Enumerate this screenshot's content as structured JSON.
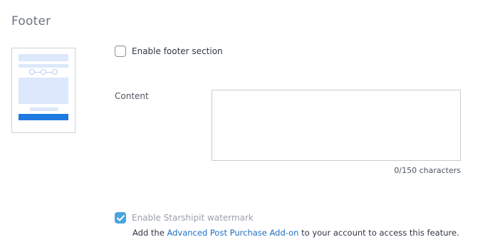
{
  "section": {
    "title": "Footer"
  },
  "enable_footer": {
    "label": "Enable footer section",
    "checked": false
  },
  "content": {
    "label": "Content",
    "value": "",
    "placeholder": "",
    "counter": "0/150 characters"
  },
  "watermark": {
    "label": "Enable Starshipit watermark",
    "checked": true,
    "disabled": true
  },
  "note": {
    "prefix": "Add the ",
    "link": "Advanced Post Purchase Add-on",
    "suffix": " to your account to access this feature."
  },
  "colors": {
    "accent": "#1f7ae0",
    "checkbox_checked": "#4aa3df",
    "link": "#1e6fc2",
    "preview_block": "#dce8fb"
  }
}
